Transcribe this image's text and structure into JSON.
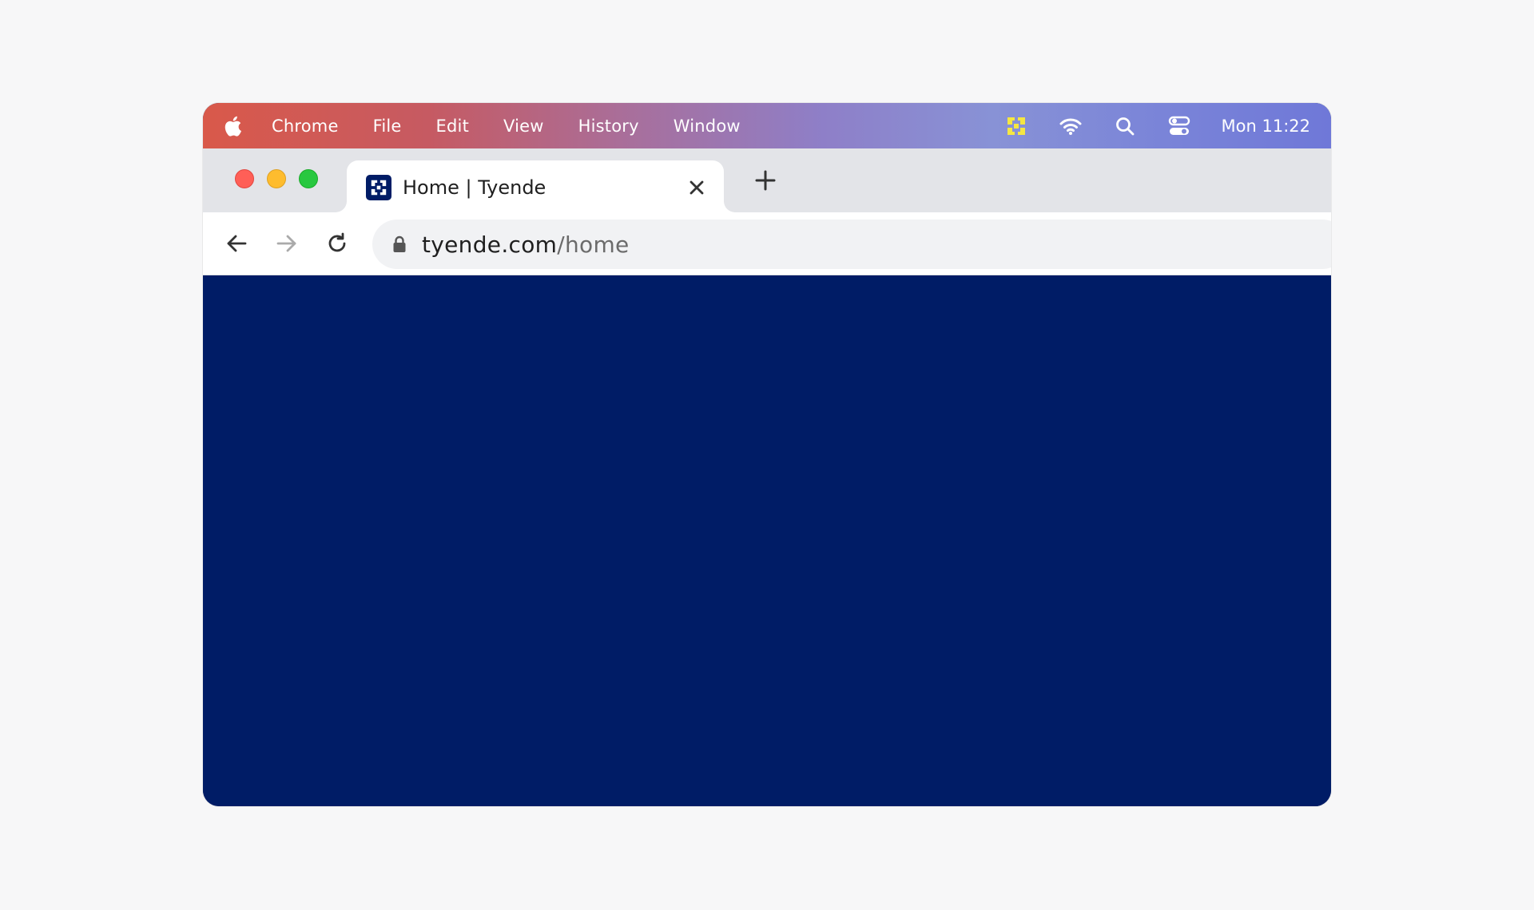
{
  "menubar": {
    "apple_icon": "apple-logo-icon",
    "app_name": "Chrome",
    "items": [
      "File",
      "Edit",
      "View",
      "History",
      "Window"
    ],
    "status_icons": [
      "tyende-app-icon",
      "wifi-icon",
      "spotlight-search-icon",
      "control-center-icon"
    ],
    "clock": "Mon 11:22"
  },
  "tab": {
    "title": "Home | Tyende",
    "favicon": "tyende-favicon-icon",
    "close_icon": "close-icon"
  },
  "toolbar": {
    "back_icon": "back-arrow-icon",
    "forward_icon": "forward-arrow-icon",
    "reload_icon": "reload-icon",
    "lock_icon": "lock-icon",
    "url_host": "tyende.com",
    "url_path": "/home"
  },
  "colors": {
    "page_background": "#001c66",
    "brand_accent": "#f5e642",
    "chrome_tabstrip": "#e3e4e8"
  }
}
